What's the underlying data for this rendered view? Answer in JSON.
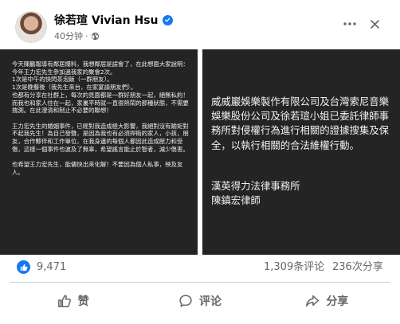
{
  "header": {
    "author_name": "徐若瑄 Vivian Hsu",
    "timestamp": "40分钟",
    "separator": "·",
    "privacy_icon": "globe-icon",
    "more_icon": "more-horizontal-icon",
    "close_icon": "close-icon",
    "verified_icon": "verified-badge-icon"
  },
  "images": {
    "left_paragraphs": [
      "今天陳鵬報導有鄰居爆料，我想鄰居是誤會了，在此想面大家說明：\n今年王力宏先生參加過我家的聚會2次。\n1次是中午的快閃茶泡飯（一群朋友）。\n1次是晚餐後（我先生來台，在家宴請朋友們）。\n也都有分享在社群上，每次的見面都是一群好朋友一起，絕無私約！而我也和家人住在一起，家裏平時就一直很熱鬧的那種狀態，不需要揣測。在此澄清和制止不必要的聯想！",
      "王力宏先生的婚姻事件，已經對我造成極大影響，我絕對沒有踰矩對不起我先生！為自己發聲，是因為我也有必須捍衛的家人，小孩，朋友，合作夥伴和工作單位，在我身邊的每個人都因此造成壓力和受傷，這樣一個事件也波及了無辜，希望謠言能止於智者，減少傷害。",
      "也希望王力宏先生，能儘快出來化解！不要因為個人私事，殃及友人。"
    ],
    "right_statement": "威威巖娛樂製作有限公司及台灣索尼音樂娛樂股份公司及徐若瑄小姐已委託律師事務所對侵權行為進行相關的證據搜集及保全，以執行相關的合法維權行動。",
    "right_signature": "漢英得力法律事務所\n陳鎮宏律師"
  },
  "stats": {
    "like_icon": "thumbs-up-icon",
    "like_count": "9,471",
    "comment_count": "1,309条评论",
    "share_count": "236次分享"
  },
  "actions": {
    "like_label": "赞",
    "comment_label": "评论",
    "share_label": "分享"
  },
  "colors": {
    "accent": "#1877f2",
    "secondary_text": "#65676b",
    "image_bg": "#242424"
  }
}
